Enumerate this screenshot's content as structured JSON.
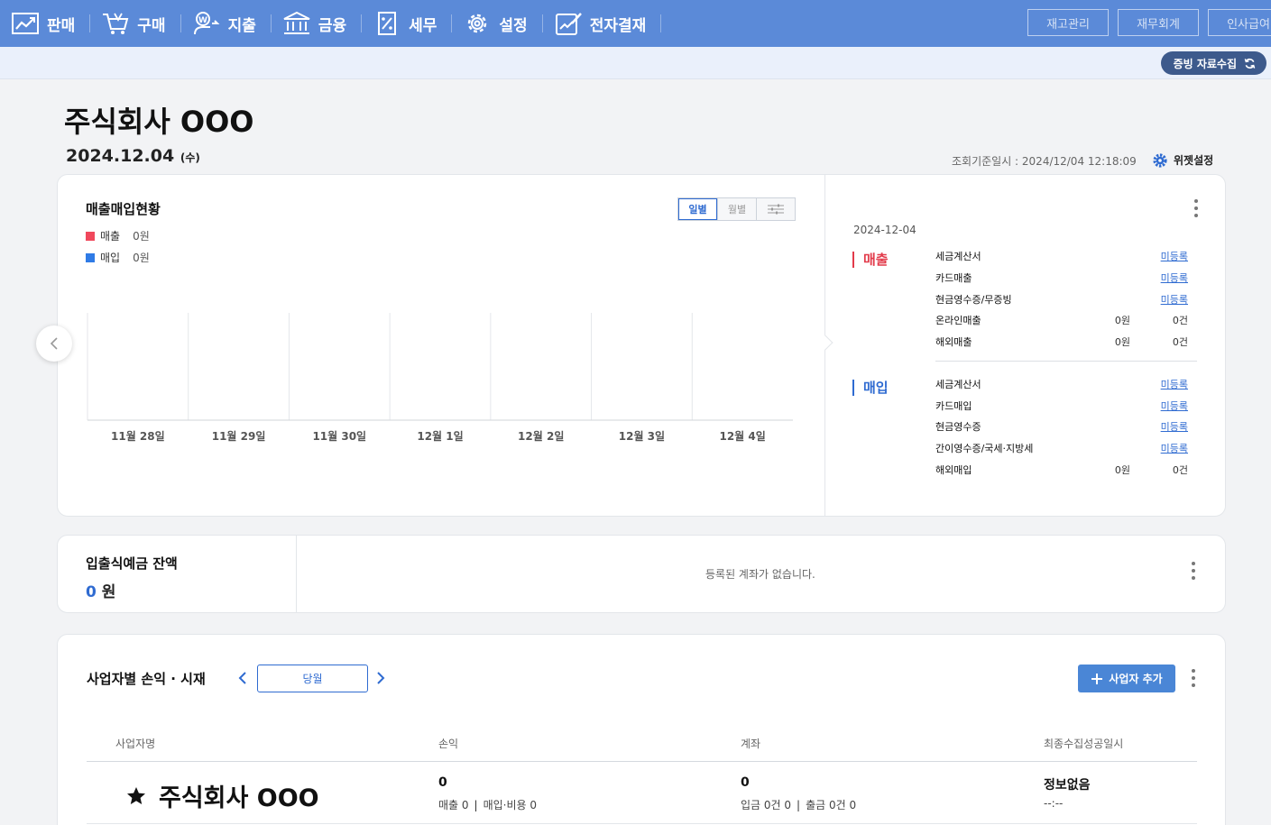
{
  "nav": {
    "items": [
      {
        "label": "판매",
        "icon": "sales-chart-icon"
      },
      {
        "label": "구매",
        "icon": "cart-icon"
      },
      {
        "label": "지출",
        "icon": "expense-icon"
      },
      {
        "label": "금융",
        "icon": "bank-icon"
      },
      {
        "label": "세무",
        "icon": "tax-document-icon"
      },
      {
        "label": "설정",
        "icon": "gear-icon"
      },
      {
        "label": "전자결재",
        "icon": "approval-icon"
      }
    ],
    "right_buttons": [
      "재고관리",
      "재무회계",
      "인사급여"
    ]
  },
  "subbar": {
    "evidence_button": "증빙 자료수집"
  },
  "header": {
    "company": "주식회사 OOO",
    "date": "2024.12.04",
    "day_of_week": "(수)",
    "query_time": "조회기준일시 : 2024/12/04 12:18:09",
    "widget_setting": "위젯설정"
  },
  "sales_purchase": {
    "title": "매출매입현황",
    "legend": [
      {
        "label": "매출",
        "value": "0원",
        "color": "#f0485c"
      },
      {
        "label": "매입",
        "value": "0원",
        "color": "#2f7be6"
      }
    ],
    "tabs": [
      "일별",
      "월별"
    ],
    "active_tab": "일별"
  },
  "chart_data": {
    "type": "bar",
    "categories": [
      "11월 28일",
      "11월 29일",
      "11월 30일",
      "12월 1일",
      "12월 2일",
      "12월 3일",
      "12월 4일"
    ],
    "series": [
      {
        "name": "매출",
        "values": [
          0,
          0,
          0,
          0,
          0,
          0,
          0
        ]
      },
      {
        "name": "매입",
        "values": [
          0,
          0,
          0,
          0,
          0,
          0,
          0
        ]
      }
    ],
    "title": "매출매입현황",
    "xlabel": "",
    "ylabel": "",
    "grid": true
  },
  "detail": {
    "date": "2024-12-04",
    "sales": {
      "title": "매출",
      "color": "#e23a4a",
      "rows": [
        {
          "label": "세금계산서",
          "status": "미등록"
        },
        {
          "label": "카드매출",
          "status": "미등록"
        },
        {
          "label": "현금영수증/무증빙",
          "status": "미등록"
        },
        {
          "label": "온라인매출",
          "amount": "0원",
          "count": "0건"
        },
        {
          "label": "해외매출",
          "amount": "0원",
          "count": "0건"
        }
      ]
    },
    "purchase": {
      "title": "매입",
      "color": "#2f6bd1",
      "rows": [
        {
          "label": "세금계산서",
          "status": "미등록"
        },
        {
          "label": "카드매입",
          "status": "미등록"
        },
        {
          "label": "현금영수증",
          "status": "미등록"
        },
        {
          "label": "간이영수증/국세·지방세",
          "status": "미등록"
        },
        {
          "label": "해외매입",
          "amount": "0원",
          "count": "0건"
        }
      ]
    }
  },
  "deposit": {
    "title": "입출식예금 잔액",
    "amount": "0",
    "unit": "원",
    "empty_message": "등록된 계좌가 없습니다."
  },
  "business": {
    "title": "사업자별 손익 · 시재",
    "period": "당월",
    "add_button": "사업자 추가",
    "columns": [
      "사업자명",
      "손익",
      "계좌",
      "최종수집성공일시"
    ],
    "rows": [
      {
        "name": "주식회사 OOO",
        "profit": "0",
        "profit_detail": [
          "매출 0",
          "매입·비용 0"
        ],
        "account": "0",
        "account_detail": [
          "입금 0건 0",
          "출금 0건 0"
        ],
        "last_collected": "정보없음",
        "last_collected_time": "--:--"
      }
    ]
  }
}
